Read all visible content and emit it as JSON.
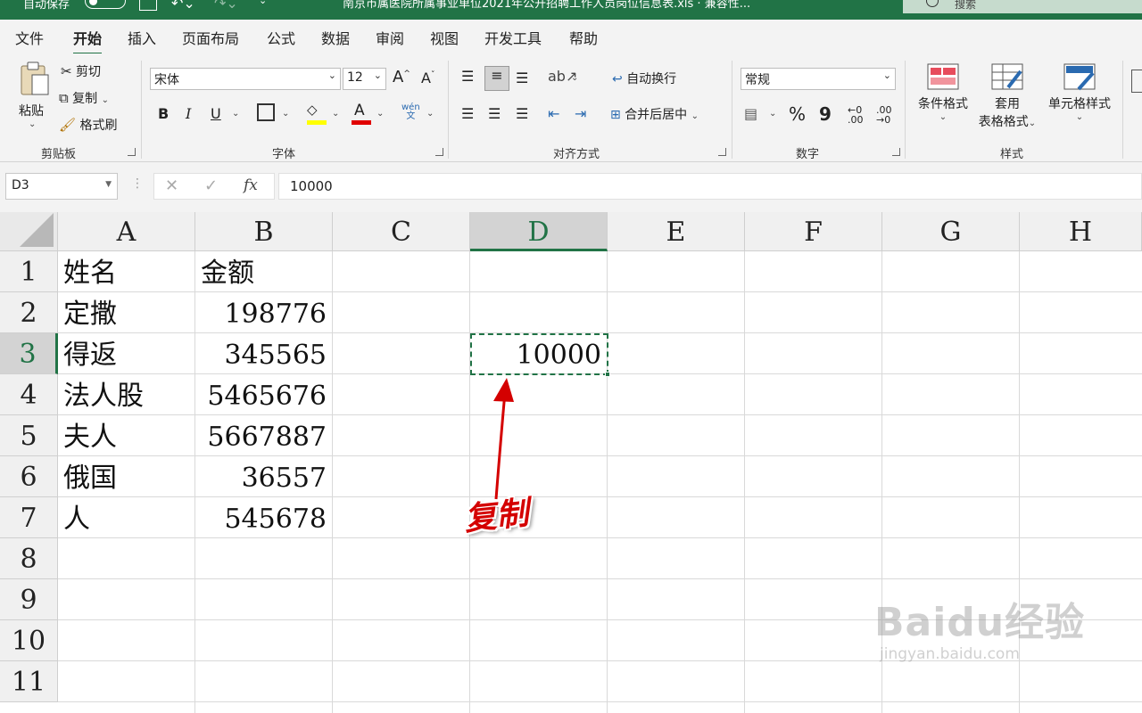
{
  "titlebar": {
    "autosave_label": "自动保存",
    "autosave_state": "off",
    "doc_title": "南京市属医院所属事业单位2021年公开招聘工作人员岗位信息表.xls · 兼容性...",
    "search_placeholder": "搜索"
  },
  "ribbon_tabs": [
    "文件",
    "开始",
    "插入",
    "页面布局",
    "公式",
    "数据",
    "审阅",
    "视图",
    "开发工具",
    "帮助"
  ],
  "active_tab": "开始",
  "ribbon": {
    "clipboard": {
      "label": "剪贴板",
      "paste": "粘贴",
      "cut": "剪切",
      "copy": "复制",
      "format_painter": "格式刷"
    },
    "font": {
      "label": "字体",
      "font_name": "宋体",
      "font_size": "12",
      "bold": "B",
      "italic": "I",
      "underline": "U",
      "font_color_letter": "A",
      "phonetic": "wén"
    },
    "alignment": {
      "label": "对齐方式",
      "wrap_text": "自动换行",
      "merge_center": "合并后居中"
    },
    "number": {
      "label": "数字",
      "format": "常规",
      "percent": "%",
      "comma": "9"
    },
    "styles": {
      "label": "样式",
      "conditional": "条件格式",
      "table_format_1": "套用",
      "table_format_2": "表格格式",
      "cell_styles": "单元格样式"
    }
  },
  "formula_bar": {
    "name_box": "D3",
    "formula": "10000",
    "fx": "fx"
  },
  "grid": {
    "columns": [
      "A",
      "B",
      "C",
      "D",
      "E",
      "F",
      "G",
      "H"
    ],
    "selected_column": "D",
    "rows": [
      "1",
      "2",
      "3",
      "4",
      "5",
      "6",
      "7",
      "8",
      "9",
      "10",
      "11"
    ],
    "selected_row": "3",
    "data": [
      {
        "a": "姓名",
        "b": "金额"
      },
      {
        "a": "定撒",
        "b": "198776"
      },
      {
        "a": "得返",
        "b": "345565"
      },
      {
        "a": "法人股",
        "b": "5465676"
      },
      {
        "a": "夫人",
        "b": "5667887"
      },
      {
        "a": "俄国",
        "b": "36557"
      },
      {
        "a": "人",
        "b": "545678"
      }
    ],
    "d3": "10000"
  },
  "annotation": "复制",
  "watermark": {
    "logo": "Baidu经验",
    "url": "jingyan.baidu.com"
  },
  "colors": {
    "excel_green": "#217346",
    "annotation_red": "#d40000"
  }
}
